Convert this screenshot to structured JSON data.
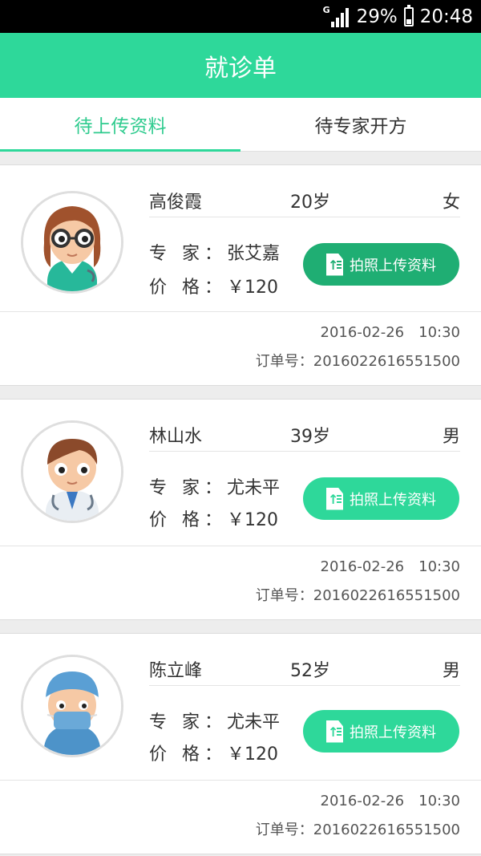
{
  "status_bar": {
    "network": "G",
    "battery": "29%",
    "time": "20:48"
  },
  "header": {
    "title": "就诊单"
  },
  "tabs": [
    {
      "label": "待上传资料",
      "active": true
    },
    {
      "label": "待专家开方",
      "active": false
    }
  ],
  "colors": {
    "brand": "#2ed89a",
    "button_dark": "#1fae73",
    "button_light": "#2ed89a"
  },
  "labels": {
    "expert": "专 家：",
    "price": "价 格：",
    "order_prefix": "订单号："
  },
  "orders": [
    {
      "name": "高俊霞",
      "age": "20岁",
      "gender": "女",
      "expert": "张艾嘉",
      "price": "￥120",
      "button": "拍照上传资料",
      "date": "2016-02-26",
      "time": "10:30",
      "order_no": "2016022616551500",
      "avatar_icon": "female-doctor-avatar-icon"
    },
    {
      "name": "林山水",
      "age": "39岁",
      "gender": "男",
      "expert": "尤未平",
      "price": "￥120",
      "button": "拍照上传资料",
      "date": "2016-02-26",
      "time": "10:30",
      "order_no": "2016022616551500",
      "avatar_icon": "male-doctor-avatar-icon"
    },
    {
      "name": "陈立峰",
      "age": "52岁",
      "gender": "男",
      "expert": "尤未平",
      "price": "￥120",
      "button": "拍照上传资料",
      "date": "2016-02-26",
      "time": "10:30",
      "order_no": "2016022616551500",
      "avatar_icon": "surgeon-avatar-icon"
    }
  ]
}
